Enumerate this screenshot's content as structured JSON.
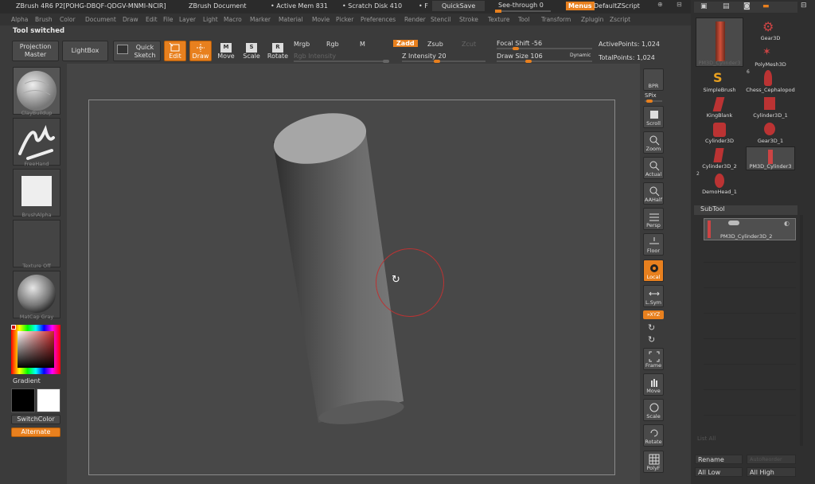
{
  "titlebar": {
    "app": "ZBrush 4R6 P2[POHG-DBQF-QDGV-MNMI-NCIR]",
    "document": "ZBrush Document",
    "active_mem": "• Active Mem 831",
    "scratch_disk": "• Scratch Disk 410",
    "more": "• F",
    "quicksave": "QuickSave",
    "seethrough": "See-through  0",
    "menus": "Menus",
    "script": "DefaultZScript"
  },
  "menu": [
    "Alpha",
    "Brush",
    "Color",
    "Document",
    "Draw",
    "Edit",
    "File",
    "Layer",
    "Light",
    "Macro",
    "Marker",
    "Material",
    "Movie",
    "Picker",
    "Preferences",
    "Render",
    "Stencil",
    "Stroke",
    "Texture",
    "Tool",
    "Transform",
    "Zplugin",
    "Zscript"
  ],
  "status": "Tool switched",
  "toolbar": {
    "projection": "Projection Master",
    "lightbox": "LightBox",
    "quicksketch": "Quick Sketch",
    "edit": "Edit",
    "draw": "Draw",
    "move": "Move",
    "scale": "Scale",
    "rotate": "Rotate",
    "mrgb": "Mrgb",
    "rgb": "Rgb",
    "m": "M",
    "rgb_intensity": "Rgb Intensity",
    "zadd": "Zadd",
    "zsub": "Zsub",
    "zcut": "Zcut",
    "z_intensity": "Z Intensity 20",
    "focal_shift": "Focal Shift -56",
    "draw_size": "Draw Size 106",
    "dynamic": "Dynamic",
    "active_points": "ActivePoints: 1,024",
    "total_points": "TotalPoints: 1,024"
  },
  "left": {
    "brush": "ClayBuildup",
    "stroke": "FreeHand",
    "alpha": "BrushAlpha",
    "texture": "Texture Off",
    "material": "MatCap Gray",
    "gradient": "Gradient",
    "switchcolor": "SwitchColor",
    "alternate": "Alternate"
  },
  "shelf": {
    "bpr": "BPR",
    "spix": "SPix",
    "scroll": "Scroll",
    "zoom": "Zoom",
    "actual": "Actual",
    "aahalf": "AAHalf",
    "persp": "Persp",
    "floor": "Floor",
    "local": "Local",
    "lsym": "L.Sym",
    "xyz": "»XYZ",
    "frame": "Frame",
    "move": "Move",
    "scale": "Scale",
    "rotate": "Rotate",
    "polyf": "PolyF"
  },
  "tools": [
    {
      "name": "PM3D_Cylinder3"
    },
    {
      "name": "Gear3D"
    },
    {
      "name": "PolyMesh3D"
    },
    {
      "name": "SimpleBrush"
    },
    {
      "name": "Chess_Cephalopod"
    },
    {
      "name": "KingBlank"
    },
    {
      "name": "Cylinder3D_1"
    },
    {
      "name": "Cylinder3D"
    },
    {
      "name": "Gear3D_1"
    },
    {
      "name": "Cylinder3D_2"
    },
    {
      "name": "PM3D_Cylinder3"
    },
    {
      "name": "DemoHead_1"
    }
  ],
  "tool_badges": {
    "polymesh": "6",
    "cyl2": "2"
  },
  "subtool": {
    "header": "SubTool",
    "item": "PM3D_Cylinder3D_2",
    "list_label": "List All",
    "rename": "Rename",
    "autoreorder": "AutoReorder",
    "all_low": "All Low",
    "all_high": "All High"
  },
  "colors": {
    "accent": "#e8801e",
    "bg": "#3b3b3b",
    "canvas": "#484848"
  }
}
